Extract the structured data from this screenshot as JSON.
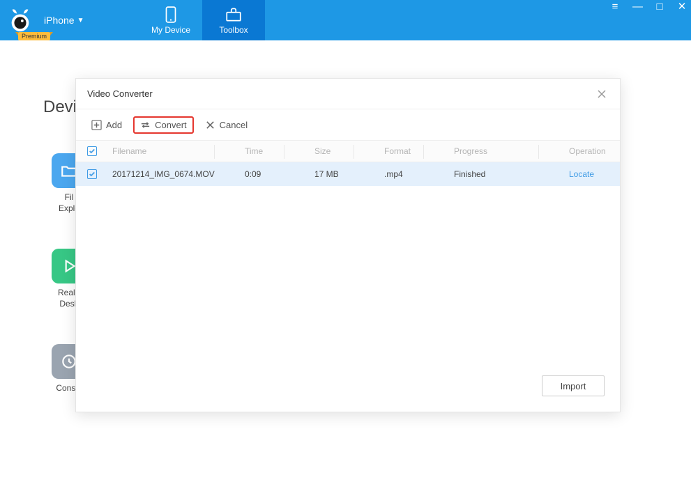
{
  "header": {
    "device_label": "iPhone",
    "premium_label": "Premium",
    "tabs": {
      "my_device": "My Device",
      "toolbox": "Toolbox"
    }
  },
  "page": {
    "title_partial": "Devic",
    "tools": {
      "file_explorer": "Fil\nExplo",
      "realtime_desk": "Real-t\nDesk",
      "console": "Consol"
    }
  },
  "modal": {
    "title": "Video Converter",
    "toolbar": {
      "add": "Add",
      "convert": "Convert",
      "cancel": "Cancel"
    },
    "columns": {
      "filename": "Filename",
      "time": "Time",
      "size": "Size",
      "format": "Format",
      "progress": "Progress",
      "operation": "Operation"
    },
    "rows": [
      {
        "filename": "20171214_IMG_0674.MOV",
        "time": "0:09",
        "size": "17 MB",
        "format": ".mp4",
        "progress": "Finished",
        "operation": "Locate"
      }
    ],
    "import_btn": "Import"
  }
}
